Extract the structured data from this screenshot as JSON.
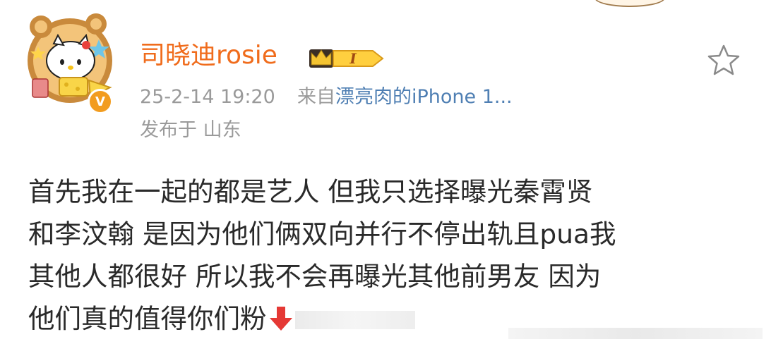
{
  "user": {
    "name": "司晓迪rosie",
    "verified_badge": "V",
    "member_level": "I"
  },
  "post": {
    "timestamp": "25-2-14 19:20",
    "source_prefix": "来自",
    "source_device": "漂亮肉的iPhone 1...",
    "location": "发布于 山东",
    "lines": [
      "首先我在一起的都是艺人 但我只选择曝光秦霄贤",
      "和李汶翰 是因为他们俩双向并行不停出轨且pua我",
      "其他人都很好 所以我不会再曝光其他前男友 因为",
      "他们真的值得你们粉"
    ]
  },
  "icons": {
    "avatar": "hello-kitty-avatar",
    "badge": "crown-member-badge-icon",
    "favorite": "star-outline-icon",
    "emoji": "red-down-arrow-icon",
    "verified": "verified-v-icon"
  },
  "colors": {
    "username": "#f06c1c",
    "meta": "#9a9a9a",
    "source_link": "#4f7fb3",
    "verified": "#f29c1f",
    "text": "#2a2a2a"
  }
}
